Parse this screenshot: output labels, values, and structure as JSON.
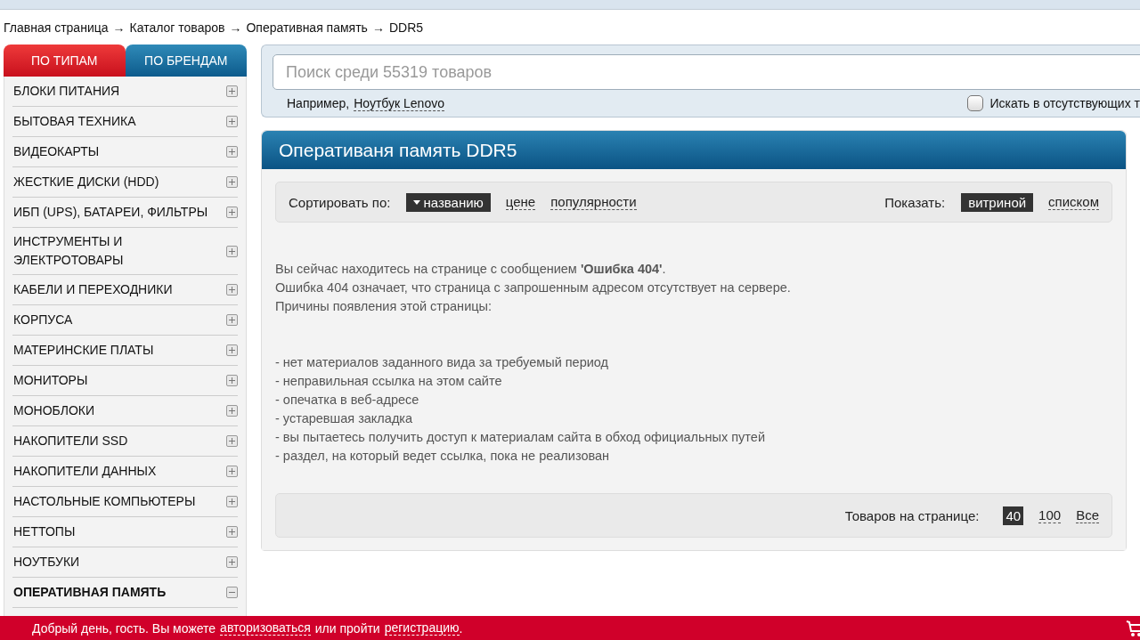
{
  "breadcrumb": [
    "Главная страница",
    "Каталог товаров",
    "Оперативная память",
    "DDR5"
  ],
  "breadcrumb_separator": "→",
  "sidebar": {
    "tabs": [
      {
        "label": "ПО ТИПАМ",
        "selected": true
      },
      {
        "label": "ПО БРЕНДАМ",
        "selected": false
      }
    ],
    "items": [
      {
        "label": "БЛОКИ ПИТАНИЯ",
        "selected": false,
        "expanded": false
      },
      {
        "label": "БЫТОВАЯ ТЕХНИКА",
        "selected": false,
        "expanded": false
      },
      {
        "label": "ВИДЕОКАРТЫ",
        "selected": false,
        "expanded": false
      },
      {
        "label": "ЖЕСТКИЕ ДИСКИ (HDD)",
        "selected": false,
        "expanded": false
      },
      {
        "label": "ИБП (UPS), БАТАРЕИ, ФИЛЬТРЫ",
        "selected": false,
        "expanded": false
      },
      {
        "label": "ИНСТРУМЕНТЫ И ЭЛЕКТРОТОВАРЫ",
        "selected": false,
        "expanded": false
      },
      {
        "label": "КАБЕЛИ И ПЕРЕХОДНИКИ",
        "selected": false,
        "expanded": false
      },
      {
        "label": "КОРПУСА",
        "selected": false,
        "expanded": false
      },
      {
        "label": "МАТЕРИНСКИЕ ПЛАТЫ",
        "selected": false,
        "expanded": false
      },
      {
        "label": "МОНИТОРЫ",
        "selected": false,
        "expanded": false
      },
      {
        "label": "МОНОБЛОКИ",
        "selected": false,
        "expanded": false
      },
      {
        "label": "НАКОПИТЕЛИ SSD",
        "selected": false,
        "expanded": false
      },
      {
        "label": "НАКОПИТЕЛИ ДАННЫХ",
        "selected": false,
        "expanded": false
      },
      {
        "label": "НАСТОЛЬНЫЕ КОМПЬЮТЕРЫ",
        "selected": false,
        "expanded": false
      },
      {
        "label": "НЕТТОПЫ",
        "selected": false,
        "expanded": false
      },
      {
        "label": "НОУТБУКИ",
        "selected": false,
        "expanded": false
      },
      {
        "label": "ОПЕРАТИВНАЯ ПАМЯТЬ",
        "selected": true,
        "expanded": true
      }
    ]
  },
  "search": {
    "placeholder": "Поиск среди 55319 товаров",
    "example_label": "Например,",
    "example_link": "Ноутбук Lenovo",
    "checkbox": {
      "label": "Искать в отсутствующих т",
      "checked": false
    }
  },
  "panel": {
    "title": "Оперативаня память DDR5",
    "sort": {
      "label": "Сортировать по:",
      "options": [
        {
          "label": "названию",
          "selected": true
        },
        {
          "label": "цене",
          "selected": false
        },
        {
          "label": "популярности",
          "selected": false
        }
      ]
    },
    "view": {
      "label": "Показать:",
      "options": [
        {
          "label": "витриной",
          "selected": true
        },
        {
          "label": "списком",
          "selected": false
        }
      ]
    },
    "message": [
      "Вы сейчас находитесь на странице с сообщением **'Ошибка 404'**.",
      "Ошибка 404 означает, что страница с запрошенным адресом отсутствует на сервере.",
      "Причины появления этой страницы:"
    ],
    "reasons": [
      "- нет материалов заданного вида за требуемый период",
      "- неправильная ссылка на этом сайте",
      "- опечатка в веб-адресе",
      "- устаревшая закладка",
      "- вы пытаетесь получить доступ к материалам сайта в обход официальных путей",
      "- раздел, на который ведет ссылка, пока не реализован"
    ],
    "per_page": {
      "label": "Товаров на странице:",
      "options": [
        {
          "label": "40",
          "selected": true
        },
        {
          "label": "100",
          "selected": false
        },
        {
          "label": "Все",
          "selected": false
        }
      ]
    }
  },
  "bottom_bar": {
    "greeting": "Добрый день, гость. Вы можете",
    "login_link": "авторизоваться",
    "middle": "или пройти",
    "register_link": "регистрацию",
    "end": "."
  }
}
